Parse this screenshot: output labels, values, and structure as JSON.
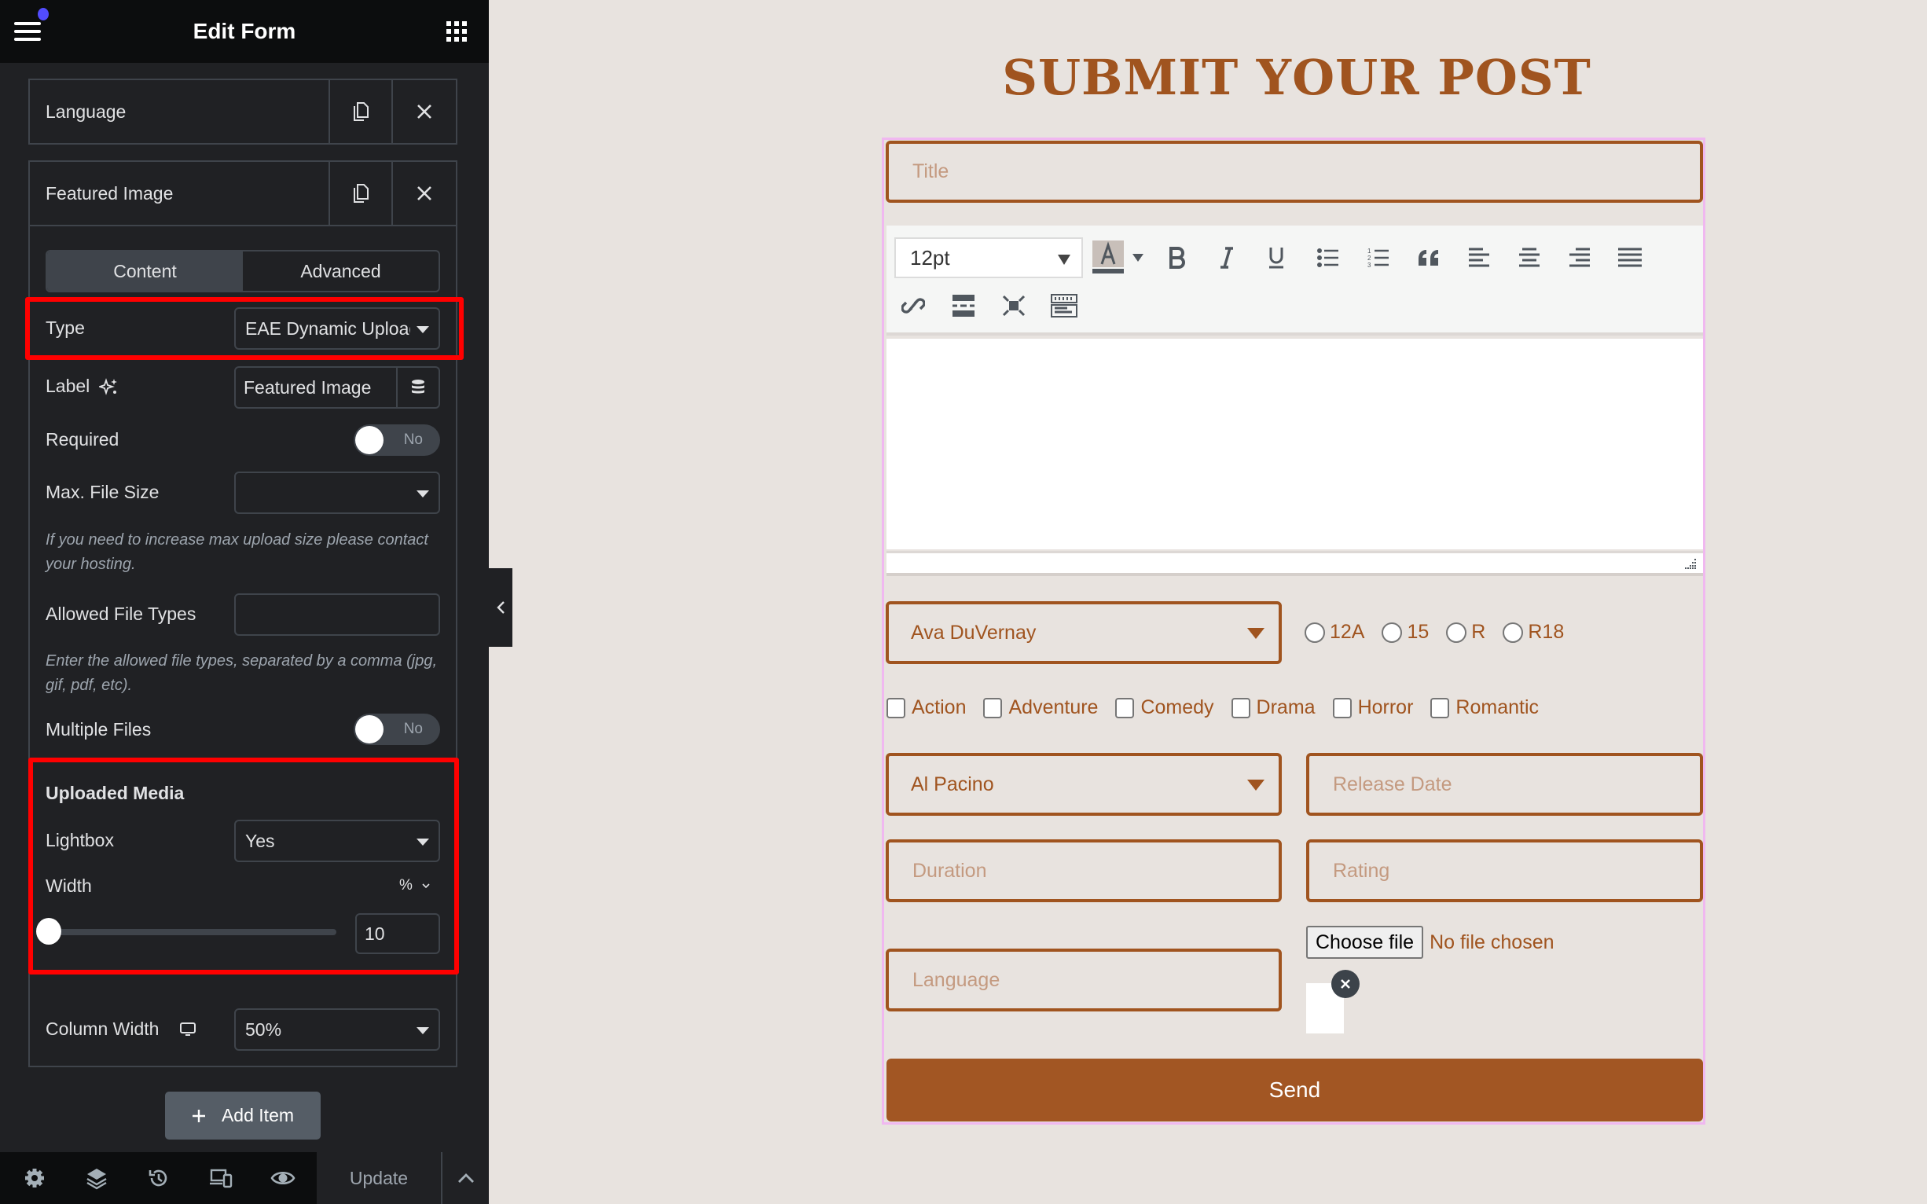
{
  "panel": {
    "title": "Edit Form",
    "repeater_items": [
      {
        "label": "Language"
      },
      {
        "label": "Featured Image"
      }
    ],
    "tabs": [
      {
        "label": "Content",
        "active": true
      },
      {
        "label": "Advanced",
        "active": false
      }
    ],
    "controls": {
      "type": {
        "label": "Type",
        "value": "EAE Dynamic Upload"
      },
      "label": {
        "label": "Label",
        "value": "Featured Image"
      },
      "required": {
        "label": "Required",
        "state": "No"
      },
      "max_file_size": {
        "label": "Max. File Size",
        "value": ""
      },
      "max_file_size_help": "If you need to increase max upload size please contact your hosting.",
      "allowed_file_types": {
        "label": "Allowed File Types",
        "value": ""
      },
      "allowed_file_types_help": "Enter the allowed file types, separated by a comma (jpg, gif, pdf, etc).",
      "multiple_files": {
        "label": "Multiple Files",
        "state": "No"
      },
      "uploaded_media": {
        "title": "Uploaded Media",
        "lightbox": {
          "label": "Lightbox",
          "value": "Yes"
        },
        "width": {
          "label": "Width",
          "unit": "%",
          "value": "10",
          "slider_fraction": 0.0
        }
      },
      "column_width": {
        "label": "Column Width",
        "value": "50%"
      }
    },
    "add_item_label": "Add Item",
    "footer": {
      "icons": [
        "settings-icon",
        "layers-icon",
        "history-icon",
        "responsive-icon",
        "preview-eye-icon"
      ],
      "update_label": "Update"
    }
  },
  "preview": {
    "heading": "SUBMIT YOUR POST",
    "title_placeholder": "Title",
    "editor": {
      "font_size": "12pt",
      "toolbar_row1": [
        "text-color",
        "text-color-dropdown",
        "bold",
        "italic",
        "underline",
        "bulleted-list",
        "numbered-list",
        "blockquote",
        "align-left",
        "align-center",
        "align-right",
        "justify"
      ],
      "toolbar_row2": [
        "link",
        "read-more",
        "fullscreen",
        "toolbar-toggle"
      ]
    },
    "director_select": "Ava DuVernay",
    "ratings": [
      "12A",
      "15",
      "R",
      "R18"
    ],
    "genres": [
      "Action",
      "Adventure",
      "Comedy",
      "Drama",
      "Horror",
      "Romantic"
    ],
    "actor_select": "Al Pacino",
    "release_date_placeholder": "Release Date",
    "duration_placeholder": "Duration",
    "rating_placeholder": "Rating",
    "language_placeholder": "Language",
    "file": {
      "button": "Choose file",
      "status": "No file chosen"
    },
    "send_label": "Send"
  },
  "colors": {
    "brand": "#a0541f",
    "panel_bg": "#202124",
    "highlight": "#ff0000",
    "page_bg": "#e8e3df"
  }
}
